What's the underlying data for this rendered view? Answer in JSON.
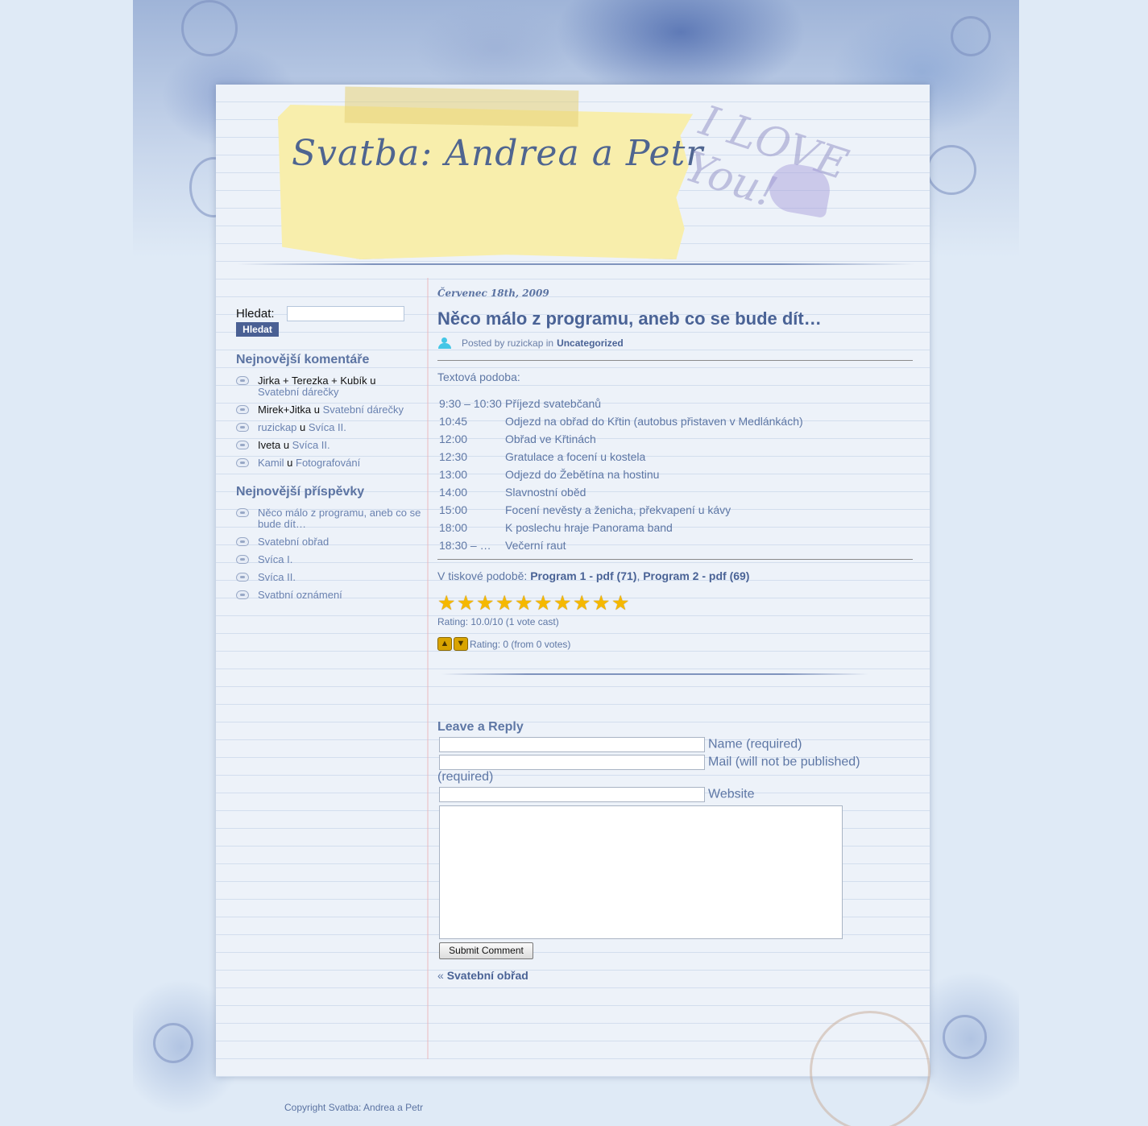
{
  "site": {
    "title": "Svatba: Andrea a Petr",
    "decor_text": "I LOVE You!"
  },
  "sidebar": {
    "search": {
      "label": "Hledat:",
      "button": "Hledat",
      "value": ""
    },
    "recent_comments": {
      "heading": "Nejnovější komentáře",
      "items": [
        {
          "author": "Jirka + Terezka + Kubík",
          "sep": "u",
          "post": "Svatební dárečky",
          "author_linked": false
        },
        {
          "author": "Mirek+Jitka",
          "sep": "u",
          "post": "Svatební dárečky",
          "author_linked": false
        },
        {
          "author": "ruzickap",
          "sep": "u",
          "post": "Svíca II.",
          "author_linked": true
        },
        {
          "author": "Iveta",
          "sep": "u",
          "post": "Svíca II.",
          "author_linked": false
        },
        {
          "author": "Kamil",
          "sep": "u",
          "post": "Fotografování",
          "author_linked": true
        }
      ]
    },
    "recent_posts": {
      "heading": "Nejnovější příspěvky",
      "items": [
        "Něco málo z programu, aneb co se bude dít…",
        "Svatební obřad",
        "Svíca I.",
        "Svíca II.",
        "Svatbní oznámení"
      ]
    }
  },
  "post": {
    "date": "Červenec 18th, 2009",
    "title": "Něco málo z programu, aneb co se bude dít…",
    "meta": {
      "prefix": "Posted by ruzickap in",
      "category": "Uncategorized"
    },
    "intro": "Textová podoba:",
    "schedule": [
      {
        "time": "9:30 – 10:30",
        "event": "Příjezd svatebčanů"
      },
      {
        "time": "10:45",
        "event": "Odjezd na obřad do Křtin (autobus přistaven v Medlánkách)"
      },
      {
        "time": "12:00",
        "event": "Obřad ve Křtinách"
      },
      {
        "time": "12:30",
        "event": "Gratulace a focení u kostela"
      },
      {
        "time": "13:00",
        "event": "Odjezd do Žebětína na hostinu"
      },
      {
        "time": "14:00",
        "event": "Slavnostní oběd"
      },
      {
        "time": "15:00",
        "event": "Focení nevěsty a ženicha, překvapení u kávy"
      },
      {
        "time": "18:00",
        "event": "K poslechu hraje Panorama band"
      },
      {
        "time": "18:30 – …",
        "event": "Večerní raut"
      }
    ],
    "print": {
      "prefix": "V tiskové podobě:",
      "link1": "Program 1 - pdf (71)",
      "sep": ",",
      "link2": "Program 2 - pdf (69)"
    },
    "rating": {
      "stars": 10,
      "max": 10,
      "text": "Rating: 10.0/10 (1 vote cast)"
    },
    "votes": {
      "text": "Rating: 0 (from 0 votes)",
      "up_icon": "thumbs-up-icon",
      "down_icon": "thumbs-down-icon"
    }
  },
  "reply": {
    "heading": "Leave a Reply",
    "name_label": "Name (required)",
    "mail_label": "Mail (will not be published) (required)",
    "website_label": "Website",
    "submit": "Submit Comment"
  },
  "nav": {
    "prev_arrow": "«",
    "prev_title": "Svatební obřad"
  },
  "footer": {
    "copyright": "Copyright Svatba: Andrea a Petr"
  },
  "colors": {
    "accent": "#4a6396",
    "link": "#6a82b0",
    "background": "#dfeaf6",
    "note": "#f8eeac"
  }
}
